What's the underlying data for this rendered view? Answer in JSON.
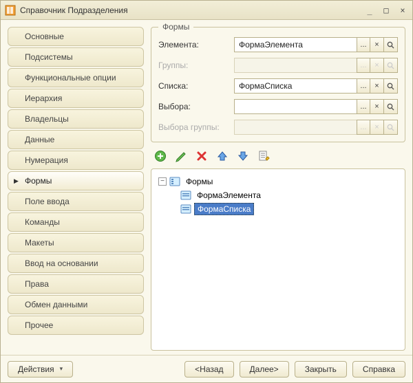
{
  "window": {
    "title": "Справочник Подразделения"
  },
  "sidebar": {
    "items": [
      {
        "label": "Основные"
      },
      {
        "label": "Подсистемы"
      },
      {
        "label": "Функциональные опции"
      },
      {
        "label": "Иерархия"
      },
      {
        "label": "Владельцы"
      },
      {
        "label": "Данные"
      },
      {
        "label": "Нумерация"
      },
      {
        "label": "Формы",
        "active": true
      },
      {
        "label": "Поле ввода"
      },
      {
        "label": "Команды"
      },
      {
        "label": "Макеты"
      },
      {
        "label": "Ввод на основании"
      },
      {
        "label": "Права"
      },
      {
        "label": "Обмен данными"
      },
      {
        "label": "Прочее"
      }
    ]
  },
  "forms_group": {
    "title": "Формы",
    "rows": {
      "element": {
        "label": "Элемента:",
        "value": "ФормаЭлемента",
        "enabled": true
      },
      "group": {
        "label": "Группы:",
        "value": "",
        "enabled": false
      },
      "list": {
        "label": "Списка:",
        "value": "ФормаСписка",
        "enabled": true
      },
      "choice": {
        "label": "Выбора:",
        "value": "",
        "enabled": true
      },
      "group_choice": {
        "label": "Выбора группы:",
        "value": "",
        "enabled": false
      }
    }
  },
  "mini_buttons": {
    "dots": "...",
    "clear": "×"
  },
  "tree": {
    "root": "Формы",
    "toggle": "−",
    "items": [
      {
        "label": "ФормаЭлемента",
        "selected": false
      },
      {
        "label": "ФормаСписка",
        "selected": true
      }
    ]
  },
  "footer": {
    "actions": "Действия",
    "back": "<Назад",
    "next": "Далее>",
    "close": "Закрыть",
    "help": "Справка"
  }
}
